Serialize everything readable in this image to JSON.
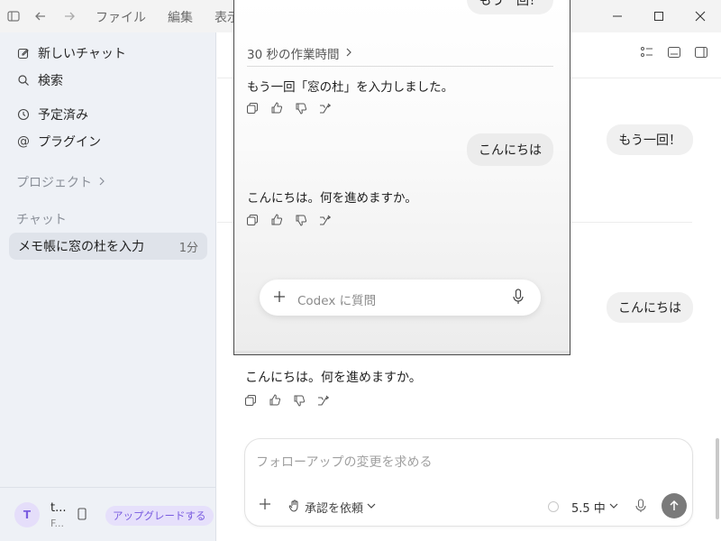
{
  "titlebar": {
    "menu": [
      "ファイル",
      "編集",
      "表示"
    ]
  },
  "sidebar": {
    "items": [
      {
        "label": "新しいチャット",
        "icon": "edit-icon"
      },
      {
        "label": "検索",
        "icon": "search-icon"
      },
      {
        "label": "予定済み",
        "icon": "clock-icon"
      },
      {
        "label": "プラグイン",
        "icon": "at-icon"
      }
    ],
    "projects_label": "プロジェクト",
    "chats_label": "チャット",
    "chat_item": {
      "title": "メモ帳に窓の杜を入力",
      "time": "1分"
    },
    "user": {
      "initial": "T",
      "name": "t...",
      "sub": "F..."
    },
    "upgrade_label": "アップグレードする"
  },
  "main": {
    "bubble_1": "もう一回！",
    "bubble_2": "こんにちは",
    "ai_reply": "こんにちは。何を進めますか。",
    "composer_placeholder": "フォローアップの変更を求める",
    "approval_label": "承認を依頼",
    "model_label": "5.5 中"
  },
  "popup": {
    "top_bubble": "もう一回！",
    "work_time": "30 秒の作業時間",
    "ai_text_1": "もう一回「窓の杜」を入力しました。",
    "bubble": "こんにちは",
    "ai_text_2": "こんにちは。何を進めますか。",
    "composer_placeholder": "Codex に質問"
  }
}
